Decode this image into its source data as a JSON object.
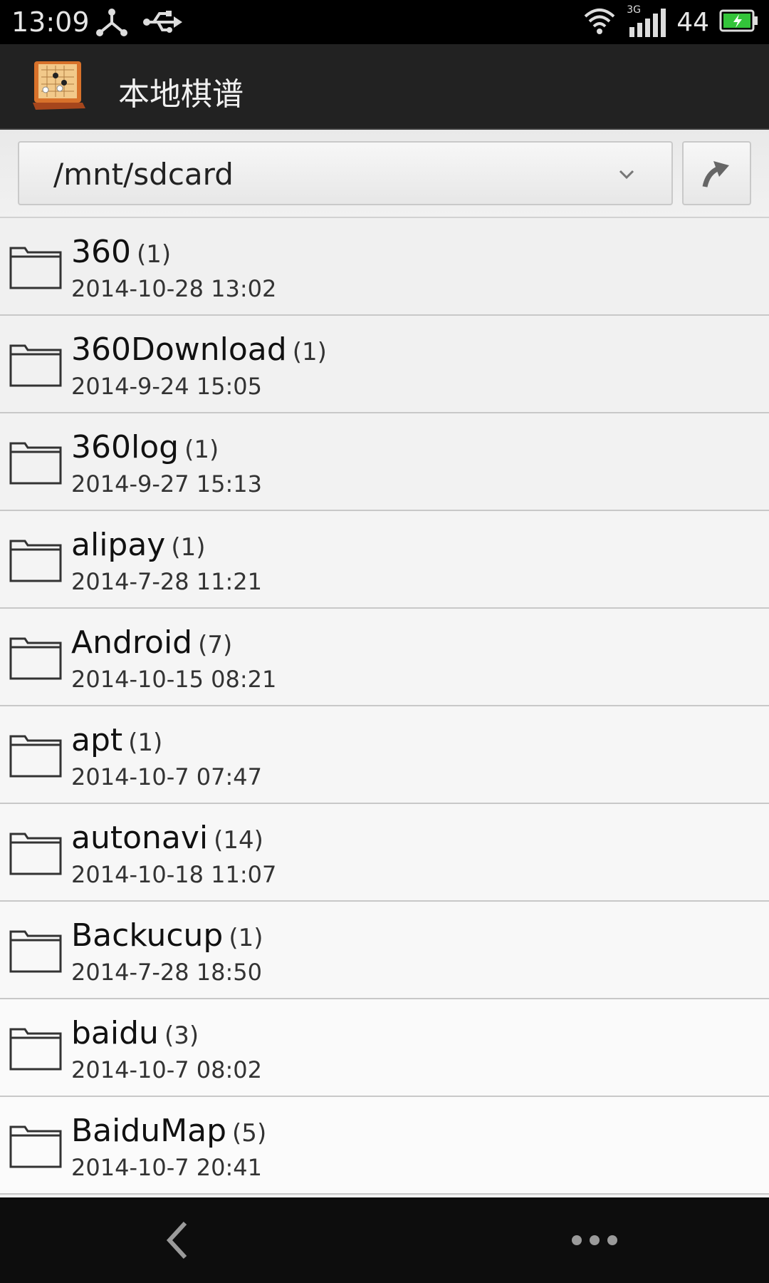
{
  "status": {
    "time": "13:09",
    "network": "3G",
    "battery": "44",
    "icons": [
      "usb-debug-icon",
      "usb-icon",
      "wifi-icon",
      "signal-icon",
      "battery-charging-icon"
    ]
  },
  "app": {
    "title": "本地棋谱",
    "icon": "go-board-icon"
  },
  "toolbar": {
    "path": "/mnt/sdcard",
    "up_icon": "folder-up-icon"
  },
  "files": [
    {
      "name": "360",
      "count": "(1)",
      "date": "2014-10-28 13:02"
    },
    {
      "name": "360Download",
      "count": "(1)",
      "date": "2014-9-24 15:05"
    },
    {
      "name": "360log",
      "count": "(1)",
      "date": "2014-9-27 15:13"
    },
    {
      "name": "alipay",
      "count": "(1)",
      "date": "2014-7-28 11:21"
    },
    {
      "name": "Android",
      "count": "(7)",
      "date": "2014-10-15 08:21"
    },
    {
      "name": "apt",
      "count": "(1)",
      "date": "2014-10-7 07:47"
    },
    {
      "name": "autonavi",
      "count": "(14)",
      "date": "2014-10-18 11:07"
    },
    {
      "name": "Backucup",
      "count": "(1)",
      "date": "2014-7-28 18:50"
    },
    {
      "name": "baidu",
      "count": "(3)",
      "date": "2014-10-7 08:02"
    },
    {
      "name": "BaiduMap",
      "count": "(5)",
      "date": "2014-10-7 20:41"
    }
  ],
  "nav": {
    "back_icon": "back-icon",
    "more_icon": "more-icon"
  }
}
